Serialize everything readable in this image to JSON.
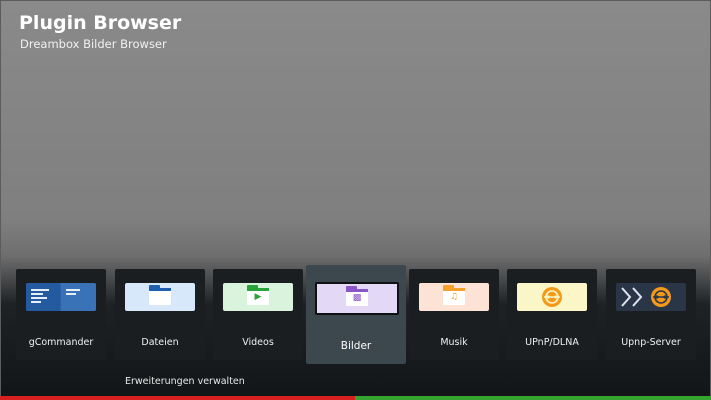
{
  "header": {
    "title": "Plugin Browser",
    "subtitle": "Dreambox Bilder Browser"
  },
  "plugins": [
    {
      "label": "gCommander",
      "icon": "gcommander-icon",
      "color": "#2b62a8"
    },
    {
      "label": "Dateien",
      "icon": "folder-documents-icon",
      "color": "#1f5fb0",
      "bg": "#d7e8fb"
    },
    {
      "label": "Videos",
      "icon": "folder-video-icon",
      "color": "#29a33a",
      "bg": "#daf3dc"
    },
    {
      "label": "Bilder",
      "icon": "folder-image-icon",
      "color": "#8a55c9",
      "bg": "#e3d9f7",
      "selected": true
    },
    {
      "label": "Musik",
      "icon": "folder-music-icon",
      "color": "#f3a12a",
      "bg": "#fde3d5"
    },
    {
      "label": "UPnP/DLNA",
      "icon": "upnp-icon",
      "color": "#f39a1a",
      "bg": "#fbf6c8"
    },
    {
      "label": "Upnp-Server",
      "icon": "upnp-server-icon",
      "color": "#f39a1a",
      "bg": "#2a3547"
    }
  ],
  "footer": {
    "manage_label": "Erweiterungen verwalten"
  },
  "colorbar": {
    "red": "#d71f1f",
    "green": "#35a530"
  }
}
